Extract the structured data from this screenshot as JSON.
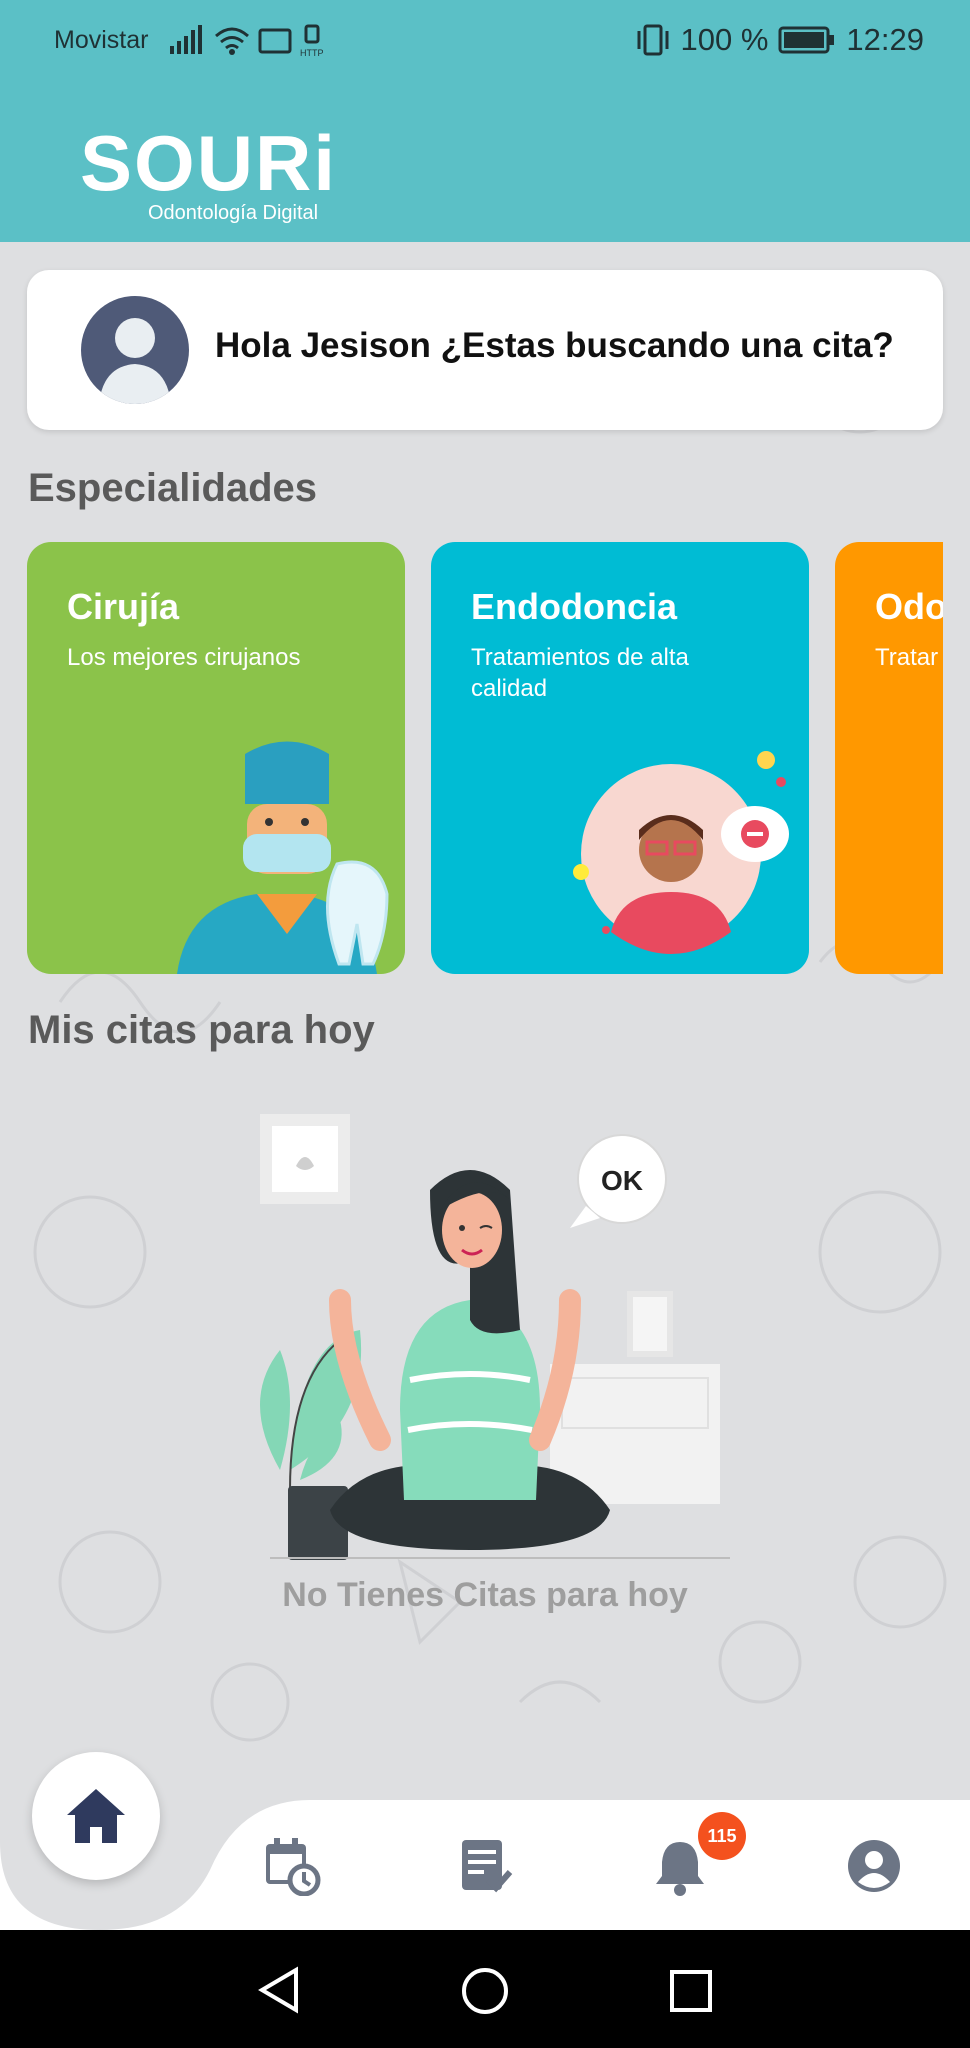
{
  "status_bar": {
    "carrier": "Movistar",
    "battery": "100 %",
    "time": "12:29"
  },
  "header": {
    "logo_text": "SOURi",
    "logo_subtitle": "Odontología Digital"
  },
  "greeting": {
    "text": "Hola Jesison ¿Estas buscando una cita?"
  },
  "sections": {
    "specialties_title": "Especialidades",
    "appointments_title": "Mis citas para hoy"
  },
  "specialties": [
    {
      "title": "Cirujía",
      "description": "Los mejores cirujanos",
      "color": "#8bc34a"
    },
    {
      "title": "Endodoncia",
      "description": "Tratamientos de alta calidad",
      "color": "#00bcd4"
    },
    {
      "title": "Odo",
      "description": "Tratar",
      "color": "#ff9800"
    }
  ],
  "empty_state": {
    "bubble_text": "OK",
    "message": "No Tienes Citas para hoy"
  },
  "bottom_nav": {
    "notifications_count": "115",
    "items": [
      "home-icon",
      "calendar-clock-icon",
      "clipboard-check-icon",
      "bell-icon",
      "account-icon"
    ]
  },
  "colors": {
    "primary": "#5bc0c6",
    "nav_icon": "#6c7585",
    "home_icon": "#2f3a5e",
    "badge": "#f4511e"
  }
}
